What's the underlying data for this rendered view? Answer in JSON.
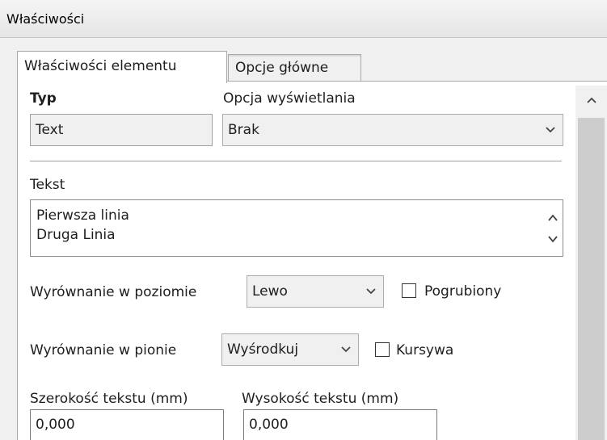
{
  "window": {
    "title": "Właściwości"
  },
  "tabs": [
    {
      "label": "Właściwości elementu",
      "active": true
    },
    {
      "label": "Opcje główne",
      "active": false
    }
  ],
  "typ": {
    "label": "Typ",
    "value": "Text"
  },
  "display_option": {
    "label": "Opcja wyświetlania",
    "value": "Brak"
  },
  "tekst": {
    "label": "Tekst",
    "lines": [
      "Pierwsza linia",
      "Druga Linia"
    ]
  },
  "halign": {
    "label": "Wyrównanie w poziomie",
    "value": "Lewo"
  },
  "bold": {
    "label": "Pogrubiony",
    "checked": false
  },
  "valign": {
    "label": "Wyrównanie w pionie",
    "value": "Wyśrodkuj"
  },
  "italic": {
    "label": "Kursywa",
    "checked": false
  },
  "text_width": {
    "label": "Szerokość tekstu (mm)",
    "value": "0,000"
  },
  "text_height": {
    "label": "Wysokość tekstu (mm)",
    "value": "0,000"
  },
  "icons": [
    "chevron-up-icon",
    "chevron-down-icon"
  ],
  "colors": {
    "accent": "#ffffff",
    "panel": "#f0f0f0",
    "border": "#a9a9a9"
  }
}
